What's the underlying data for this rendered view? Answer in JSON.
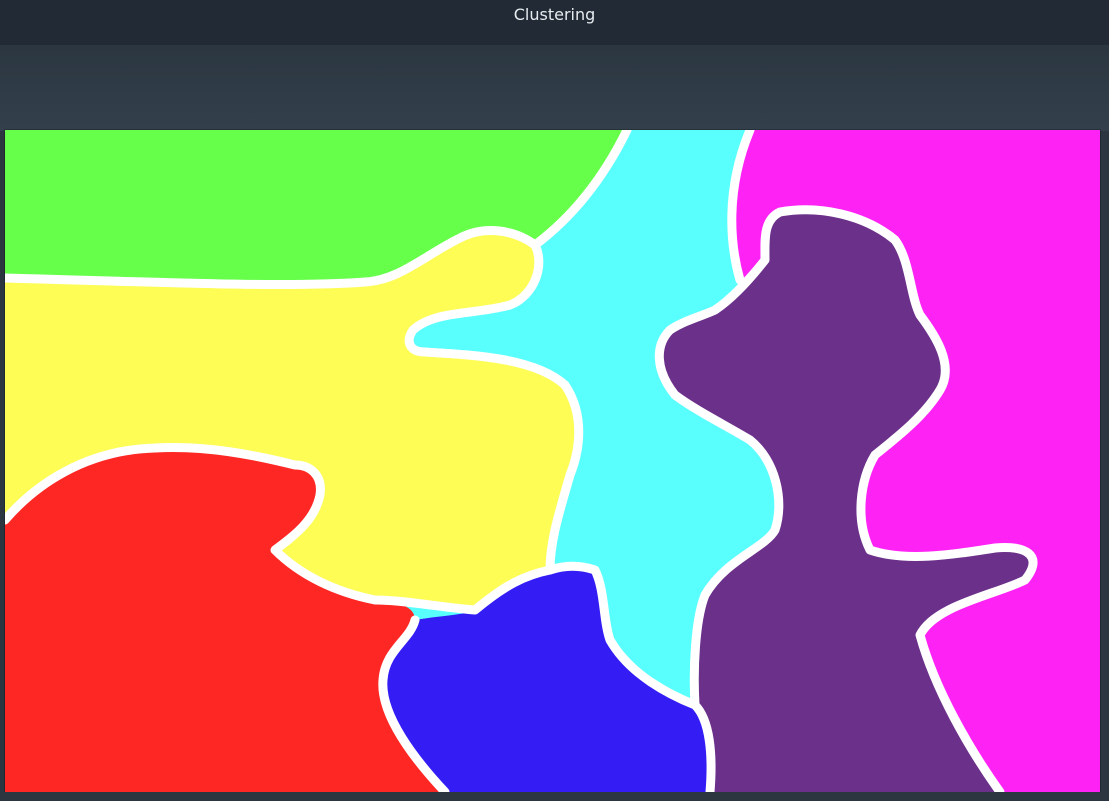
{
  "window": {
    "title": "Clustering"
  },
  "clusters": [
    {
      "name": "green",
      "color": "#66ff4a"
    },
    {
      "name": "yellow",
      "color": "#fdfd55"
    },
    {
      "name": "cyan",
      "color": "#59fffd"
    },
    {
      "name": "magenta",
      "color": "#ff22f5"
    },
    {
      "name": "purple",
      "color": "#6b308a"
    },
    {
      "name": "red",
      "color": "#ff2723"
    },
    {
      "name": "blue",
      "color": "#341cf5"
    }
  ],
  "colors": {
    "titlebar_bg": "#222b35",
    "toolbar_bg": "#2b3640",
    "boundary": "#ffffff"
  }
}
